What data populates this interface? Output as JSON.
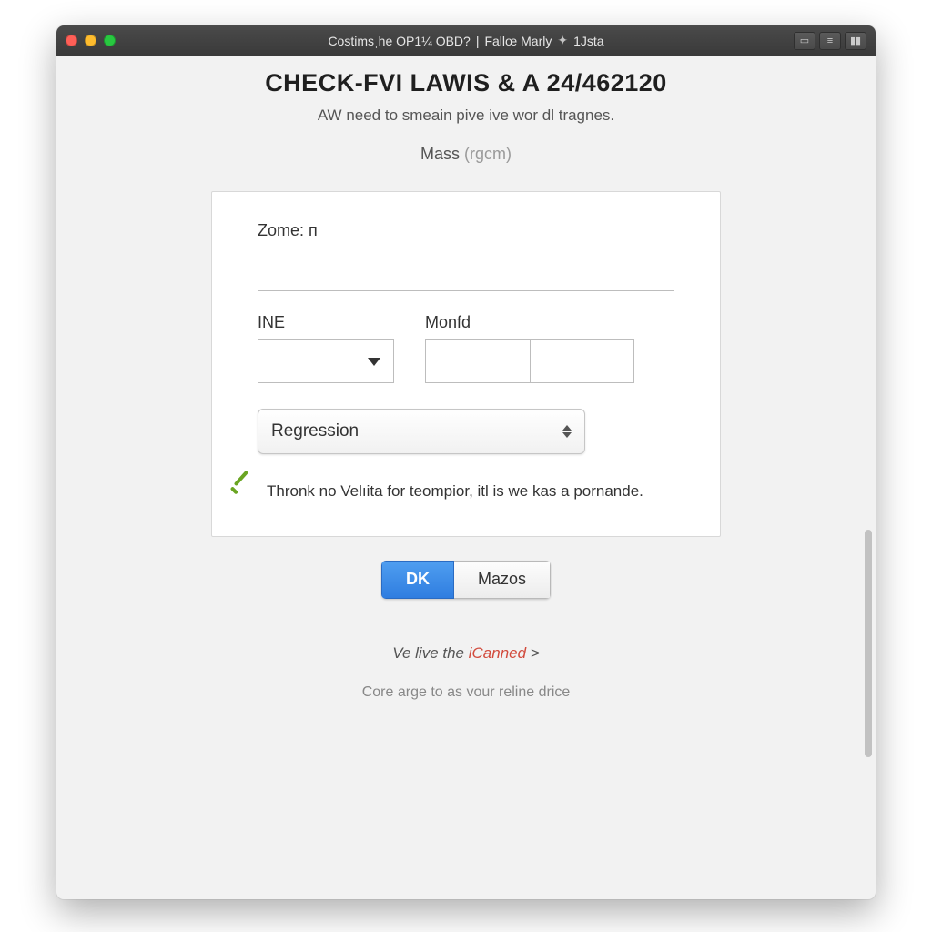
{
  "window": {
    "title_left": "Costimsˌhe OP1¼ OBD?",
    "title_right": "Fallœ Marly ",
    "title_suffix": " 1Jsta"
  },
  "page": {
    "heading": "CHECK-FVI LAWIS & A 24/462120",
    "subtitle": "AW need to smeain pive ive wor dl tragnes.",
    "mass_label": "Mass",
    "mass_unit": "(rgcm)"
  },
  "form": {
    "zome_label": "Zome: ᴨ",
    "zome_value": "",
    "ine_label": "INE",
    "monfd_label": "Monfd",
    "regression_selected": "Regression",
    "note_text": "Thronk no Velıita for teompior, itl is we kas a pornande."
  },
  "buttons": {
    "primary": "DK",
    "secondary": "Mazos"
  },
  "footer": {
    "line1_pre": "Ve live the ",
    "line1_em": "iCanned",
    "line1_post": " >",
    "line2": "Core arge to as vour reline drice"
  }
}
